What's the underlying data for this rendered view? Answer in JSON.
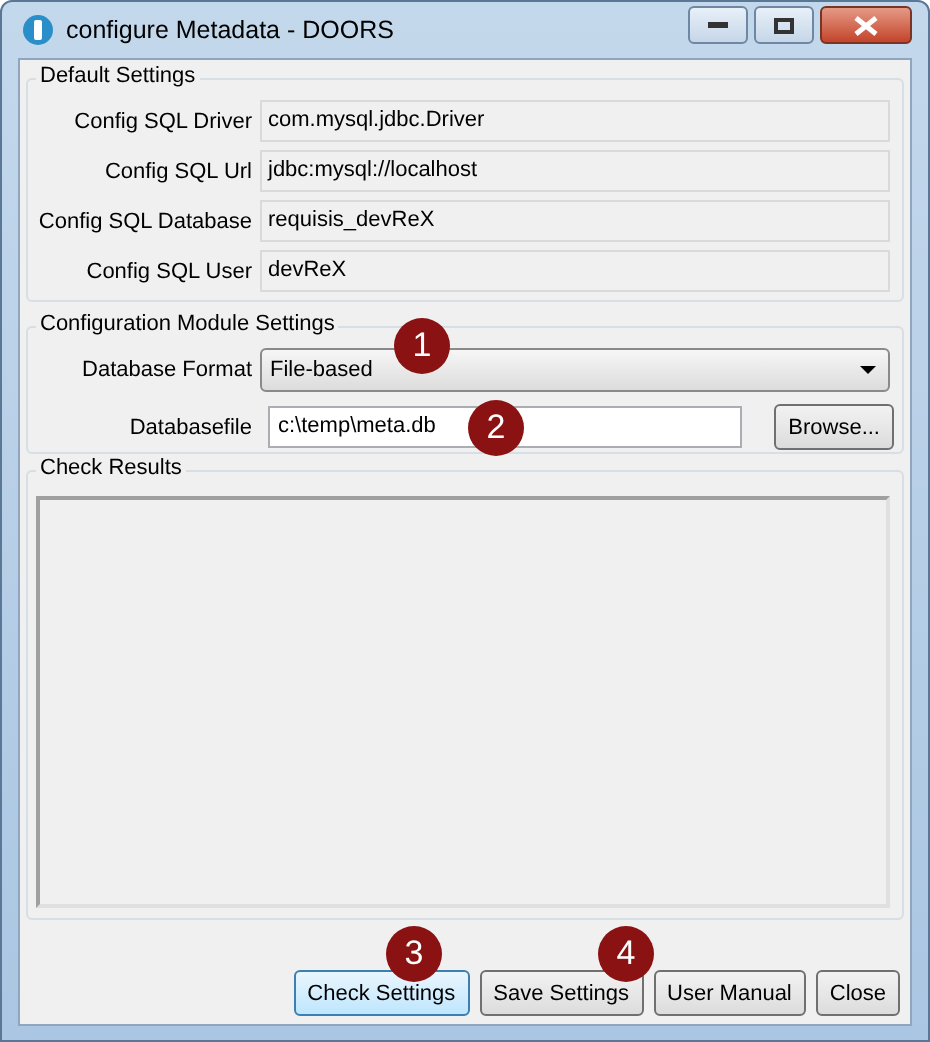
{
  "window": {
    "title": "configure Metadata - DOORS"
  },
  "default_settings": {
    "title": "Default Settings",
    "fields": [
      {
        "label": "Config SQL Driver",
        "value": "com.mysql.jdbc.Driver"
      },
      {
        "label": "Config SQL Url",
        "value": "jdbc:mysql://localhost"
      },
      {
        "label": "Config SQL Database",
        "value": "requisis_devReX"
      },
      {
        "label": "Config SQL User",
        "value": "devReX"
      }
    ]
  },
  "module_settings": {
    "title": "Configuration Module Settings",
    "format_label": "Database Format",
    "format_value": "File-based",
    "file_label": "Databasefile",
    "file_value": "c:\\temp\\meta.db",
    "browse": "Browse..."
  },
  "check_results": {
    "title": "Check Results"
  },
  "buttons": [
    {
      "label": "Check Settings",
      "focused": true
    },
    {
      "label": "Save Settings",
      "focused": false
    },
    {
      "label": "User Manual",
      "focused": false
    },
    {
      "label": "Close",
      "focused": false
    }
  ],
  "callouts": [
    "1",
    "2",
    "3",
    "4"
  ]
}
